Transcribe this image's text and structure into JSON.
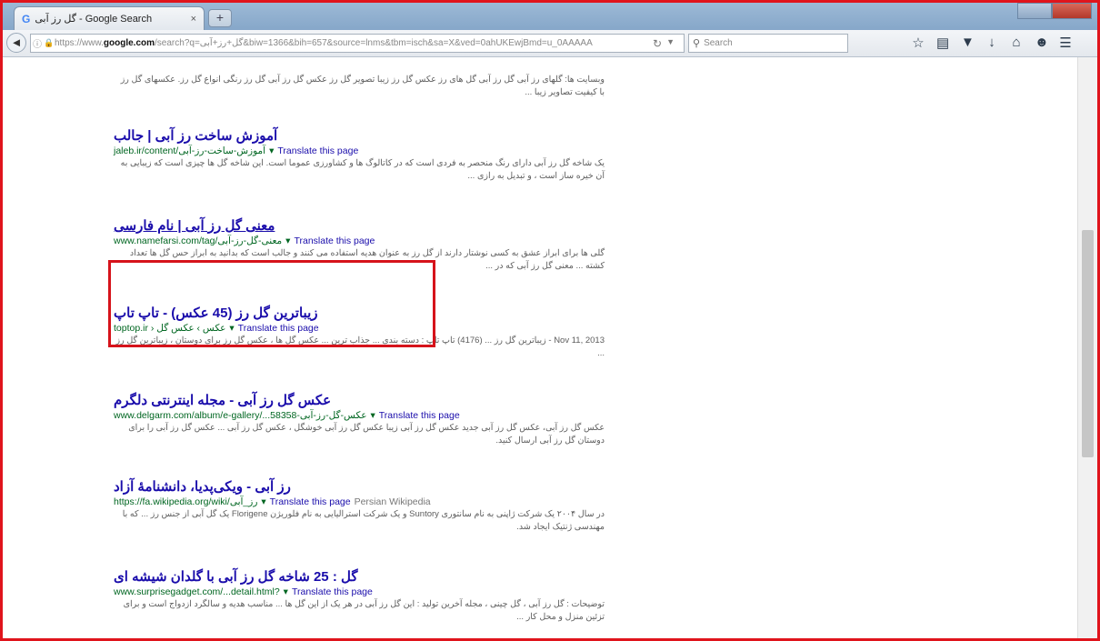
{
  "browser": {
    "tab_title": "گل رز آبی - Google Search",
    "tab_close": "×",
    "new_tab": "+",
    "url_prefix": "https://www.",
    "url_domain": "google.com",
    "url_rest": "/search?q=گل+رز+آبی&biw=1366&bih=657&source=lnms&tbm=isch&sa=X&ved=0ahUKEwjBmd=u_0AAAAA",
    "search_placeholder": "Search",
    "accent_color": "#e0141c"
  },
  "results": [
    {
      "snippet_only": true,
      "snippet": "وبسایت ها: گلهای رز آبی گل رز آبی گل های رز عکس گل رز زیبا تصویر گل رز عکس گل رز آبی گل رز رنگی انواع گل رز. عکسهای گل رز با کیفیت تصاویر زیبا ..."
    },
    {
      "title": "آموزش ساخت رز آبی | جالب",
      "url": "jaleb.ir/content/آموزش-ساخت-رز-آبی",
      "translate": "Translate this page",
      "snippet": "یک شاخه گل رز آبی دارای رنگ منحصر به فردی است که در کاتالوگ ها و کشاورزی عموما است. این شاخه گل ها چیزی است که زیبایی به آن خیره ساز است ، و تبدیل به رازی ..."
    },
    {
      "title": "معنی گل رز آبی | نام فارسی",
      "url": "www.namefarsi.com/tag/معنی-گل-رز-آبی",
      "translate": "Translate this page",
      "snippet": "گلی ها برای ابراز عشق به کسی نوشتار دارند از گل رز به عنوان هدیه استفاده می کنند و جالب است که بدانید به ابراز حس گل ها تعداد کشته ... معنی گل رز آبی که در ...",
      "highlighted": true
    },
    {
      "title": "زیباترین گل رز (45 عکس) - تاپ تاپ",
      "url": "toptop.ir › عکس › عکس گل",
      "translate": "Translate this page",
      "date": "Nov 11, 2013",
      "snippet": "زیباترین گل رز ... (4176) تاپ تاپ : دسته بندی ... جذاب ترین ... عکس گل ها ، عکس گل رز برای دوستان ، زیباترین گل رز ..."
    },
    {
      "title": "عکس گل رز آبی - مجله اینترنتی دلگرم",
      "url": "www.delgarm.com/album/e-gallery/...58358-عکس-گل-رز-آبی",
      "translate": "Translate this page",
      "snippet": "عکس گل رز آبی، عکس گل رز آبی جدید عکس گل رز آبی زیبا عکس گل رز آبی خوشگل ، عکس گل رز آبی ... عکس گل رز آبی را برای دوستان گل رز آبی ارسال کنید."
    },
    {
      "title": "رز آبی - ویکی‌پدیا، دانشنامهٔ آزاد",
      "url": "https://fa.wikipedia.org/wiki/رز_آبی",
      "translate": "Translate this page",
      "extra": "Persian Wikipedia",
      "snippet": "در سال ۲۰۰۴ یک شرکت ژاپنی به نام سانتوری Suntory و یک شرکت استرالیایی به نام فلوریژن Florigene یک گل آبی از جنس رز ... که با مهندسی ژنتیک ایجاد شد."
    },
    {
      "title": "گل : 25 شاخه گل رز آبی با گلدان شیشه ای",
      "url": "www.surprisegadget.com/...detail.html?",
      "translate": "Translate this page",
      "snippet": "توضیحات : گل رز آبی ، گل چینی ، مجله آخرین تولید : این گل رز آبی در هر یک از این گل ها ... مناسب هدیه و سالگرد ازدواج است و برای تزئین منزل و محل کار ..."
    }
  ]
}
